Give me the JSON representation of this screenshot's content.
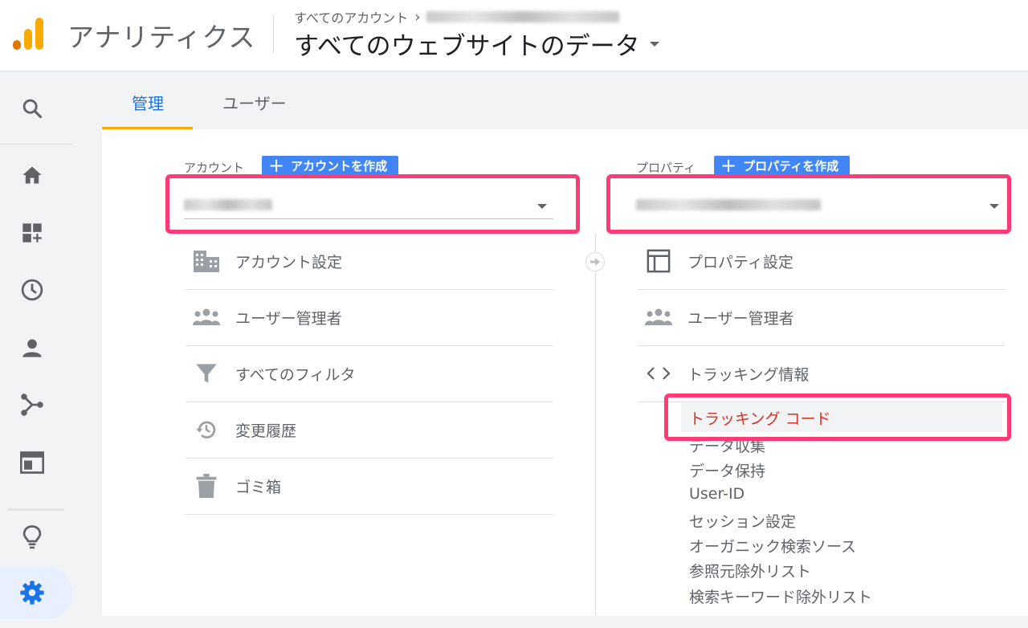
{
  "header": {
    "app_name": "アナリティクス",
    "breadcrumb_root": "すべてのアカウント",
    "breadcrumb_sep": "›",
    "view_name": "すべてのウェブサイトのデータ"
  },
  "tabs": [
    {
      "label": "管理",
      "active": true
    },
    {
      "label": "ユーザー",
      "active": false
    }
  ],
  "account": {
    "label": "アカウント",
    "create_button": "アカウントを作成",
    "menu": [
      {
        "label": "アカウント設定",
        "icon": "building-icon"
      },
      {
        "label": "ユーザー管理者",
        "icon": "people-icon"
      },
      {
        "label": "すべてのフィルタ",
        "icon": "filter-icon"
      },
      {
        "label": "変更履歴",
        "icon": "history-icon"
      },
      {
        "label": "ゴミ箱",
        "icon": "trash-icon"
      }
    ]
  },
  "property": {
    "label": "プロパティ",
    "create_button": "プロパティを作成",
    "menu": [
      {
        "label": "プロパティ設定",
        "icon": "layout-icon"
      },
      {
        "label": "ユーザー管理者",
        "icon": "people-icon"
      },
      {
        "label": "トラッキング情報",
        "icon": "code-icon"
      }
    ],
    "tracking_sub": {
      "active": "トラッキング コード",
      "items": [
        "データ収集",
        "データ保持",
        "User-ID",
        "セッション設定",
        "オーガニック検索ソース",
        "参照元除外リスト",
        "検索キーワード除外リスト"
      ]
    }
  },
  "colors": {
    "accent_blue": "#1a73e8",
    "tab_underline": "#f9ab00",
    "highlight": "#ff3b77",
    "active_sub": "#d93025"
  }
}
